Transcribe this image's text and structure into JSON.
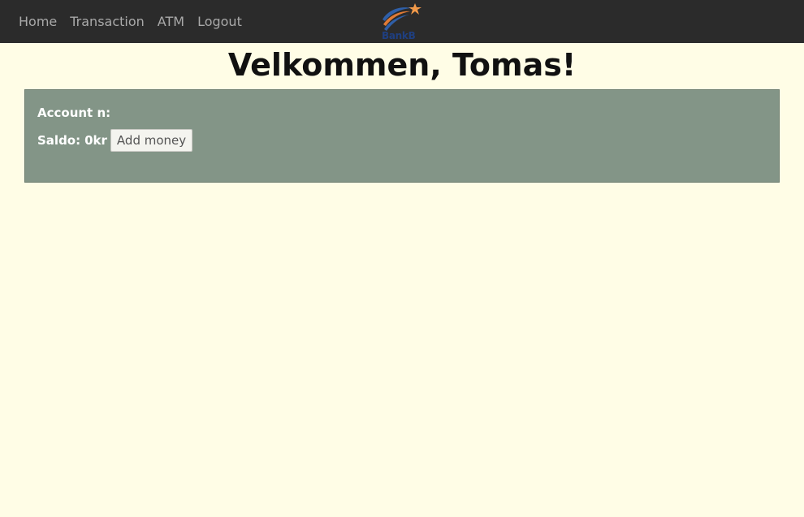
{
  "nav": {
    "items": [
      {
        "label": "Home"
      },
      {
        "label": "Transaction"
      },
      {
        "label": "ATM"
      },
      {
        "label": "Logout"
      }
    ],
    "logo_text": "BankB"
  },
  "main": {
    "welcome": "Velkommen, Tomas!"
  },
  "account": {
    "number_label": "Account n:",
    "saldo_label": "Saldo:",
    "saldo_value": "0kr",
    "add_money_label": "Add money"
  },
  "colors": {
    "navbar_bg": "#2b2b2b",
    "page_bg": "#fffde6",
    "account_box_bg": "#839587",
    "logo_orange": "#f29a4a",
    "logo_blue": "#2f5fa8"
  }
}
